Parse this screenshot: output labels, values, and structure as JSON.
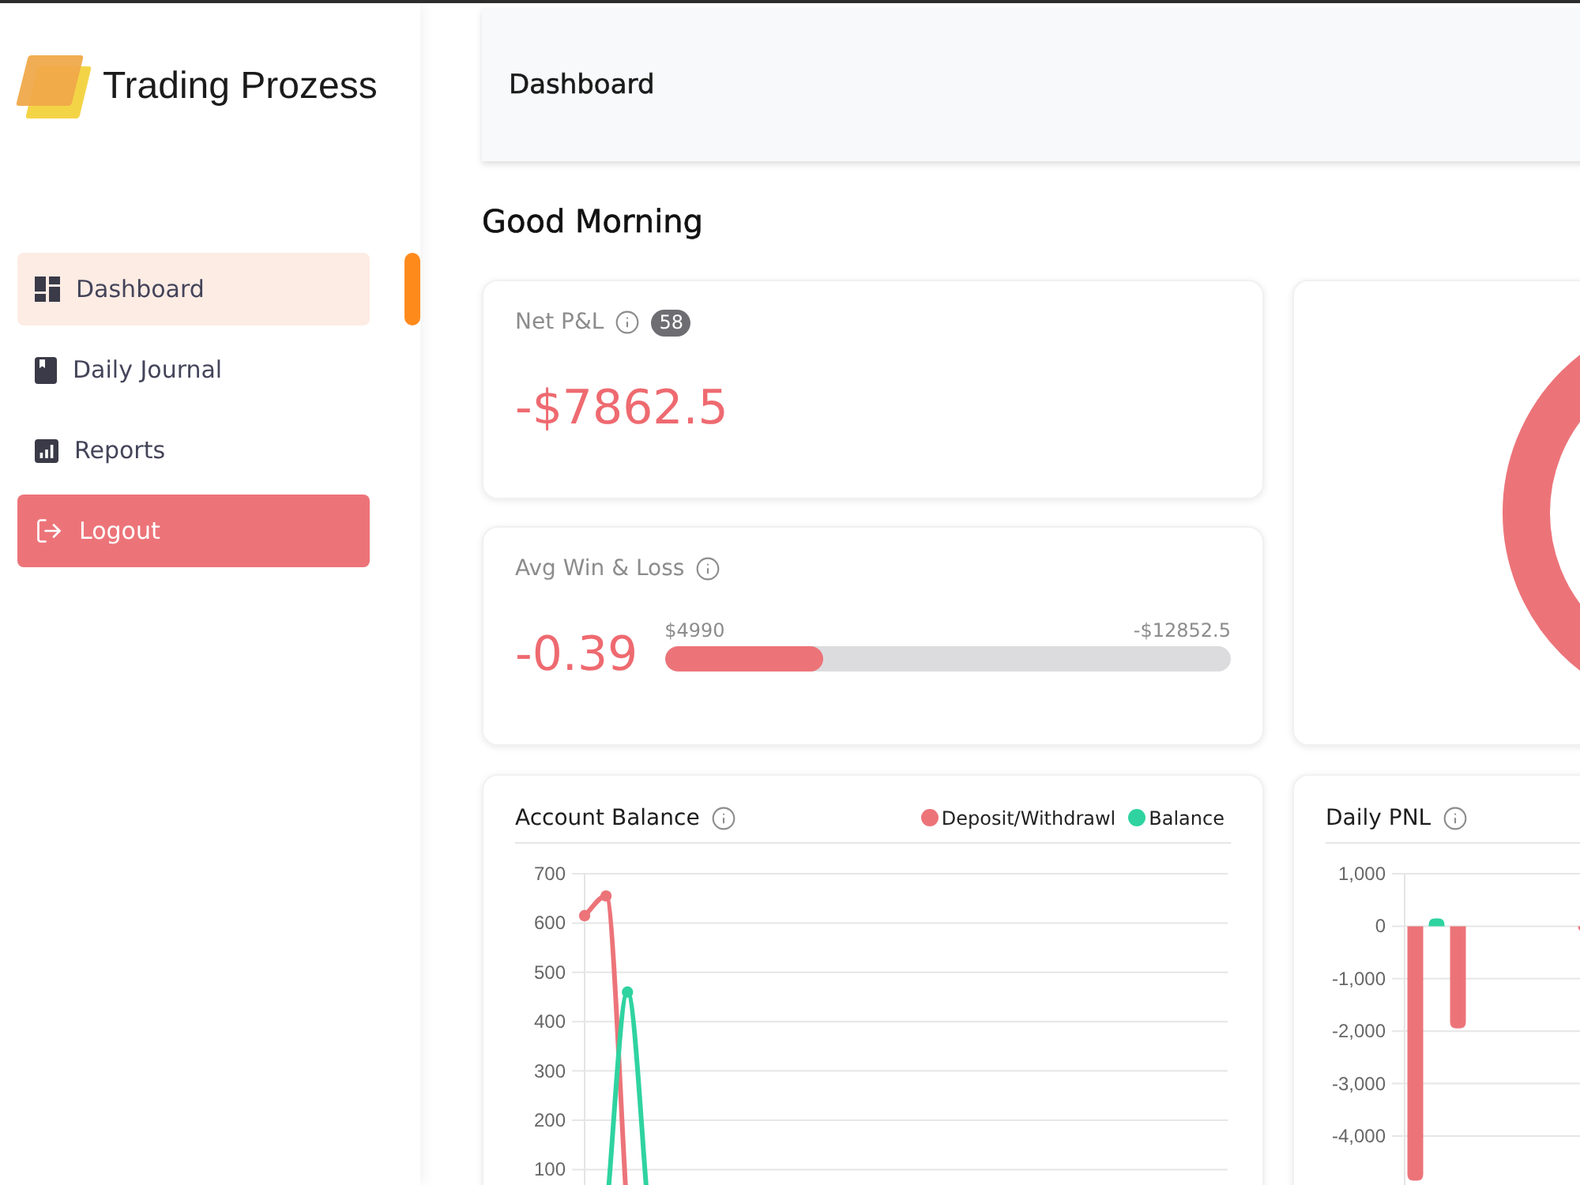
{
  "sidebar": {
    "logo": {
      "text": "Trading Prozess"
    },
    "items": [
      {
        "label": "Dashboard",
        "selected": true
      },
      {
        "label": "Daily Journal",
        "selected": false
      },
      {
        "label": "Reports",
        "selected": false
      }
    ],
    "logout_button": {
      "label": "Logout"
    }
  },
  "header": {
    "title": "Dashboard"
  },
  "greeting": "Good Morning",
  "net_pnl": {
    "label": "Net P&L",
    "badge": "58",
    "value": "-$7862.5"
  },
  "avg_win_loss": {
    "label": "Avg Win & Loss",
    "value": "-0.39",
    "bar": {
      "level": 0.28,
      "start_label": "$4990",
      "end_label": "-$12852.5"
    }
  },
  "account_balance": {
    "title": "Account Balance",
    "chart_data": {
      "type": "line",
      "grid": true,
      "categories": [
        null,
        null,
        null,
        null,
        null,
        null,
        null,
        null,
        null,
        null,
        null,
        null,
        null,
        null,
        null,
        null,
        null,
        null,
        null,
        null,
        null,
        null,
        null,
        null,
        null,
        null,
        null,
        null,
        null,
        null,
        null
      ],
      "ylim": [
        0,
        700
      ],
      "yticks": [
        100,
        200,
        300,
        400,
        500,
        600,
        700
      ],
      "series": [
        {
          "name": "Deposit/Withdrawl",
          "color": "#ec7479",
          "values": [
            615,
            655,
            0,
            null,
            null,
            null,
            null,
            null,
            null,
            null,
            null,
            null,
            null,
            null,
            null,
            null,
            null,
            null,
            null,
            null,
            null,
            null,
            null,
            null,
            null,
            null,
            null,
            null,
            null,
            null,
            null
          ]
        },
        {
          "name": "Balance",
          "color": "#2fd3a0",
          "values": [
            null,
            0,
            460,
            0,
            null,
            null,
            null,
            null,
            null,
            null,
            null,
            null,
            null,
            null,
            null,
            null,
            null,
            null,
            null,
            null,
            null,
            null,
            null,
            null,
            null,
            null,
            null,
            null,
            null,
            null,
            null
          ]
        }
      ]
    }
  },
  "daily_pnl": {
    "title": "Daily PNL",
    "chart_data": {
      "type": "bar",
      "grid": true,
      "categories": [
        null,
        null,
        null,
        null,
        null,
        null,
        null,
        null,
        null,
        null,
        null,
        null,
        null,
        null,
        null,
        null,
        null,
        null,
        null,
        null,
        null,
        null,
        null,
        null,
        null,
        null,
        null,
        null,
        null,
        null
      ],
      "ylim": [
        -6000,
        1000
      ],
      "yticks": [
        {
          "value": 1000,
          "label": "1,000"
        },
        0,
        {
          "value": -1000,
          "label": "-1,000"
        },
        {
          "value": -2000,
          "label": "-2,000"
        },
        {
          "value": -3000,
          "label": "-3,000"
        },
        {
          "value": -4000,
          "label": "-4,000"
        }
      ],
      "values": [
        -4850,
        150,
        -1950,
        null,
        null,
        null,
        null,
        null,
        -100,
        null,
        null,
        null,
        null,
        null,
        null,
        null,
        null,
        null,
        null,
        null,
        null,
        null,
        null,
        null,
        null,
        null,
        null,
        null,
        null,
        null
      ]
    }
  }
}
